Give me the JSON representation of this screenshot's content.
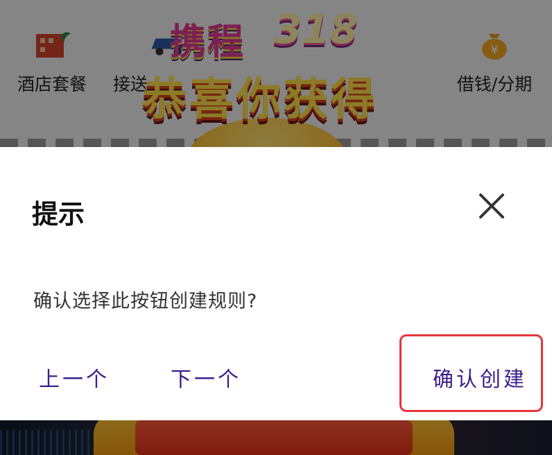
{
  "background_nav": [
    {
      "label": "酒店套餐",
      "icon": "hotel-icon"
    },
    {
      "label": "接送",
      "icon": "car-icon"
    },
    {
      "label": "借钱/分期",
      "icon": "money-bag-icon"
    }
  ],
  "promo": {
    "brand": "携程",
    "event": "318",
    "headline": "恭喜你获得"
  },
  "dialog": {
    "title": "提示",
    "message": "确认选择此按钮创建规则?",
    "prev_label": "上一个",
    "next_label": "下一个",
    "confirm_label": "确认创建"
  },
  "colors": {
    "accent": "#3b1f8a",
    "highlight": "#e8333a",
    "dialog_bg": "#ffffff"
  }
}
